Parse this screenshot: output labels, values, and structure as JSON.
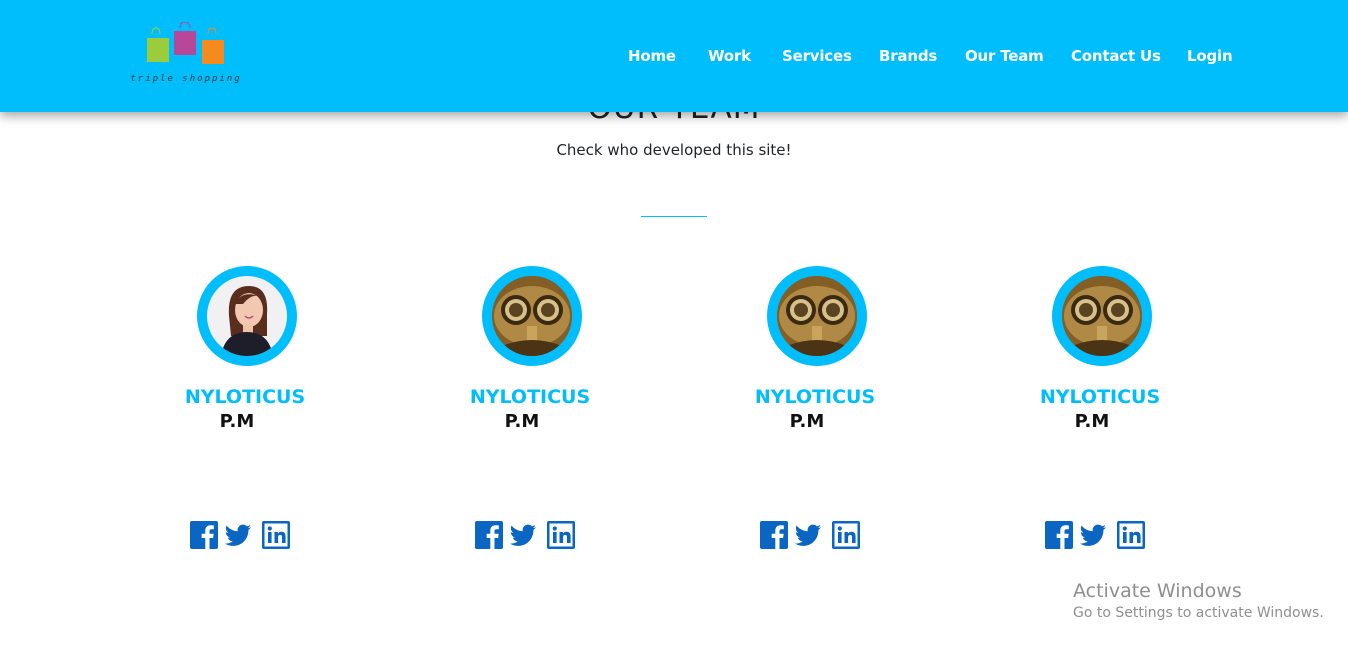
{
  "header": {
    "logo_text": "triple shopping",
    "nav": [
      "Home",
      "Work",
      "Services",
      "Brands",
      "Our Team",
      "Contact Us",
      "Login"
    ]
  },
  "section": {
    "title": "OUR TEAM",
    "subtitle": "Check who developed this site!"
  },
  "team": [
    {
      "name": "NYLOTICUS",
      "role": "P.M",
      "photo": "woman-portrait"
    },
    {
      "name": "NYLOTICUS",
      "role": "P.M",
      "photo": "goggles-mask"
    },
    {
      "name": "NYLOTICUS",
      "role": "P.M",
      "photo": "goggles-mask"
    },
    {
      "name": "NYLOTICUS",
      "role": "P.M",
      "photo": "goggles-mask"
    }
  ],
  "social_icons": [
    "facebook-icon",
    "twitter-icon",
    "linkedin-icon"
  ],
  "watermark": {
    "title": "Activate Windows",
    "subtitle": "Go to Settings to activate Windows."
  },
  "colors": {
    "brand": "#00bdfc",
    "social": "#0a66c2",
    "bag_green": "#9bcc3c",
    "bag_purple": "#b8479a",
    "bag_orange": "#f58a1f"
  }
}
